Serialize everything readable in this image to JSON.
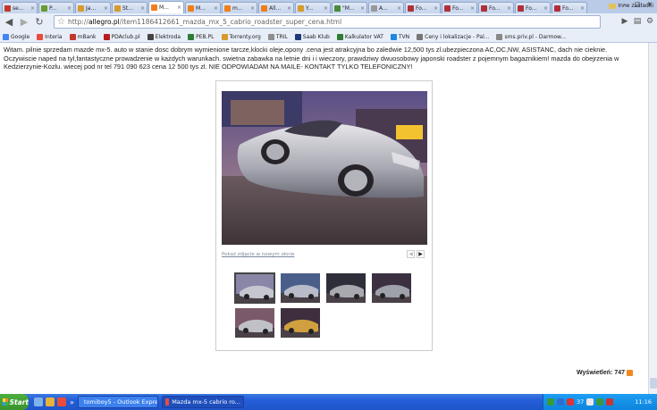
{
  "tabs": [
    {
      "label": "se...",
      "color": "#c0392b",
      "active": false
    },
    {
      "label": "P...",
      "color": "#6b9a2e",
      "active": false
    },
    {
      "label": "Ja...",
      "color": "#d69b2b",
      "active": false
    },
    {
      "label": "St...",
      "color": "#d69b2b",
      "active": false
    },
    {
      "label": "M...",
      "color": "#f07f1b",
      "active": true
    },
    {
      "label": "M...",
      "color": "#f07f1b",
      "active": false
    },
    {
      "label": "m...",
      "color": "#f07f1b",
      "active": false
    },
    {
      "label": "All...",
      "color": "#f07f1b",
      "active": false
    },
    {
      "label": "Y...",
      "color": "#d69b2b",
      "active": false
    },
    {
      "label": "\"M...",
      "color": "#4a8b3a",
      "active": false
    },
    {
      "label": "A...",
      "color": "#999999",
      "active": false
    },
    {
      "label": "Fo...",
      "color": "#b0303a",
      "active": false
    },
    {
      "label": "Fo...",
      "color": "#b0303a",
      "active": false
    },
    {
      "label": "Fo...",
      "color": "#b0303a",
      "active": false
    },
    {
      "label": "Fo...",
      "color": "#b0303a",
      "active": false
    },
    {
      "label": "Fo...",
      "color": "#b0303a",
      "active": false
    }
  ],
  "toolbar": {
    "url_prefix": "http://",
    "url_host": "allegro.pl",
    "url_path": "/item1186412661_mazda_mx_5_cabrio_roadster_super_cena.html"
  },
  "bookmarks": [
    {
      "label": "Google",
      "color": "#4285f4"
    },
    {
      "label": "Interia",
      "color": "#e94b3c"
    },
    {
      "label": "mBank",
      "color": "#c0392b"
    },
    {
      "label": "PDAclub.pl",
      "color": "#b71c1c"
    },
    {
      "label": "Elektroda",
      "color": "#444444"
    },
    {
      "label": "PEB.PL",
      "color": "#2e7d32"
    },
    {
      "label": "Torrenty.org",
      "color": "#d69b2b"
    },
    {
      "label": "TRIL",
      "color": "#8e8e8e"
    },
    {
      "label": "Saab Klub",
      "color": "#1e3a78"
    },
    {
      "label": "Kalkulator VAT",
      "color": "#2e7d32"
    },
    {
      "label": "TVN",
      "color": "#1e88e5"
    },
    {
      "label": "Ceny i lokalizacje - Pal...",
      "color": "#777777"
    },
    {
      "label": "sms.priv.pl - Darmow...",
      "color": "#888888"
    }
  ],
  "bookmarks_other": "Inne zakładki",
  "description": "Witam. pilnie sprzedam mazde mx-5. auto w stanie dosc dobrym wymienione tarcze,klocki oleje,opony .cena jest atrakcyjna bo zaledwie 12,500 tys zl.ubezpieczona AC,OC,NW, ASISTANC, dach nie cieknie. Oczywiscie naped na tyl,fantastyczne prowadzenie w każdych warunkach. swietna zabawka na letnie dni i i wieczory, prawdziwy dwuosobowy japonski roadster z pojemnym bagaznikiem! mazda do obejrzenia w Kedzierzynie-Kozlu. wiecej pod nr tel 791 090 623 cena 12 500 tys zl. NIE ODPOWIADAM NA MAILE- KONTAKT TYLKO TELEFONICZNY!",
  "gallery": {
    "open_link": "Pokaż zdjęcie w nowym oknie",
    "prev": "◀",
    "next": "▶",
    "thumbs_count": 6
  },
  "views_label": "Wyświetleń: 747",
  "taskbar": {
    "start": "Start",
    "tasks": [
      {
        "label": "tomiboy5 - Outlook Express",
        "active": false
      },
      {
        "label": "Mazda mx-5 cabrio ro...",
        "active": true
      }
    ],
    "tray_text": "37",
    "clock": "11:16"
  }
}
